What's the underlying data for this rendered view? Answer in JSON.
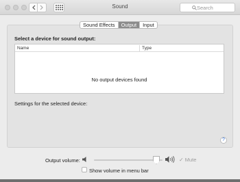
{
  "window": {
    "title": "Sound"
  },
  "search": {
    "placeholder": "Search"
  },
  "tabs": [
    {
      "label": "Sound Effects",
      "active": false
    },
    {
      "label": "Output",
      "active": true
    },
    {
      "label": "Input",
      "active": false
    }
  ],
  "output": {
    "heading": "Select a device for sound output:",
    "columns": [
      "Name",
      "Type"
    ],
    "empty_message": "No output devices found",
    "settings_label": "Settings for the selected device:"
  },
  "footer": {
    "volume_label": "Output volume:",
    "volume_level": 0.93,
    "mute_label": "Mute",
    "mute_checked": true,
    "show_volume_label": "Show volume in menu bar",
    "show_volume_checked": false
  },
  "help": {
    "label": "?"
  },
  "colors": {
    "accent": "#2a6bd6",
    "tab_active": "#8b8b8b"
  }
}
